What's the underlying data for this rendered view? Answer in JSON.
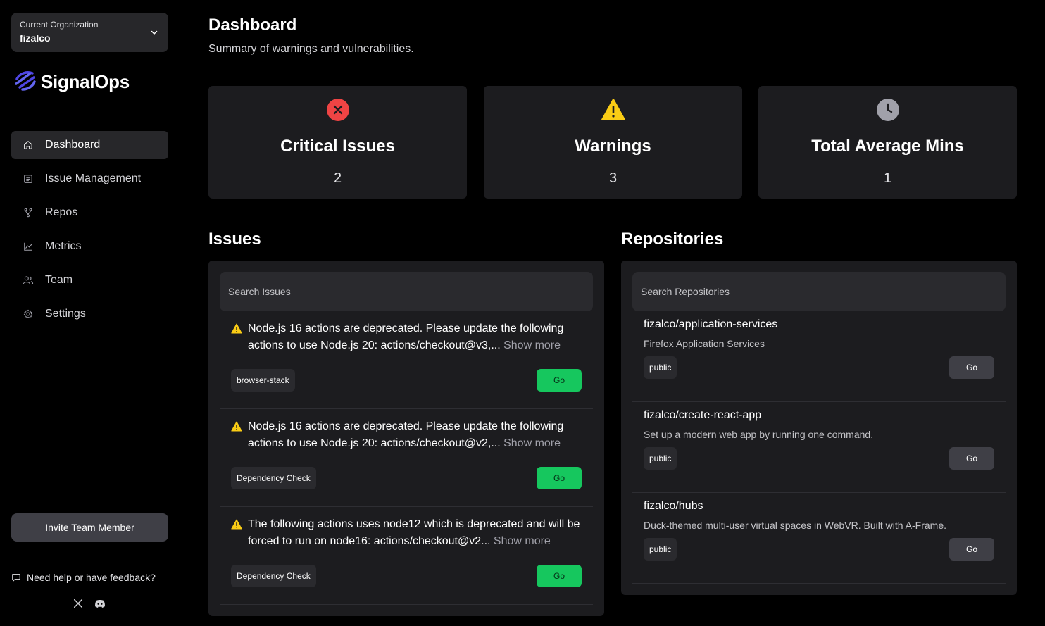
{
  "org": {
    "label": "Current Organization",
    "name": "fizalco"
  },
  "brand": {
    "name": "SignalOps",
    "accent": "#4f46e5"
  },
  "nav": [
    {
      "label": "Dashboard",
      "icon": "home-icon",
      "active": true
    },
    {
      "label": "Issue Management",
      "icon": "list-icon"
    },
    {
      "label": "Repos",
      "icon": "git-branch-icon"
    },
    {
      "label": "Metrics",
      "icon": "chart-line-icon"
    },
    {
      "label": "Team",
      "icon": "users-icon"
    },
    {
      "label": "Settings",
      "icon": "gear-icon"
    }
  ],
  "sidebar": {
    "invite_label": "Invite Team Member",
    "feedback_label": "Need help or have feedback?"
  },
  "page": {
    "title": "Dashboard",
    "subtitle": "Summary of warnings and vulnerabilities."
  },
  "stats": [
    {
      "title": "Critical Issues",
      "value": "2",
      "icon": "x-circle-icon",
      "color": "#ef4444"
    },
    {
      "title": "Warnings",
      "value": "3",
      "icon": "warning-icon",
      "color": "#facc15"
    },
    {
      "title": "Total Average Mins",
      "value": "1",
      "icon": "clock-icon",
      "color": "#a1a1aa"
    }
  ],
  "issues": {
    "title": "Issues",
    "search_placeholder": "Search Issues",
    "show_more_label": "Show more",
    "go_label": "Go",
    "items": [
      {
        "text": "Node.js 16 actions are deprecated. Please update the following actions to use Node.js 20: actions/checkout@v3,...",
        "tag": "browser-stack"
      },
      {
        "text": "Node.js 16 actions are deprecated. Please update the following actions to use Node.js 20: actions/checkout@v2,...",
        "tag": "Dependency Check"
      },
      {
        "text": "The following actions uses node12 which is deprecated and will be forced to run on node16: actions/checkout@v2...",
        "tag": "Dependency Check"
      }
    ]
  },
  "repositories": {
    "title": "Repositories",
    "search_placeholder": "Search Repositories",
    "go_label": "Go",
    "items": [
      {
        "name": "fizalco/application-services",
        "description": "Firefox Application Services",
        "visibility": "public"
      },
      {
        "name": "fizalco/create-react-app",
        "description": "Set up a modern web app by running one command.",
        "visibility": "public"
      },
      {
        "name": "fizalco/hubs",
        "description": "Duck-themed multi-user virtual spaces in WebVR. Built with A-Frame.",
        "visibility": "public"
      }
    ]
  },
  "colors": {
    "go_green": "#16c75e",
    "card_bg": "#1c1c1f"
  }
}
